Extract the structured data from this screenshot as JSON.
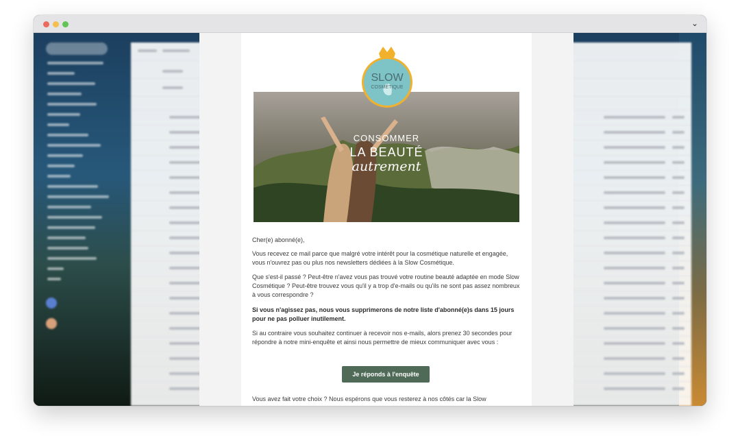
{
  "window": {
    "controls": [
      "close-icon",
      "minimize-icon",
      "zoom-icon"
    ],
    "chevron": "⌄"
  },
  "email": {
    "logo": {
      "top": "SLOW",
      "bottom": "COSMÉTIQUE"
    },
    "hero": {
      "line1": "CONSOMMER",
      "line2": "LA BEAUTÉ",
      "line3": "autrement"
    },
    "greeting": "Cher(e) abonné(e),",
    "paragraphs": [
      "Vous recevez ce mail parce que malgré votre intérêt pour la cosmétique naturelle et engagée, vous n'ouvrez pas ou plus nos newsletters dédiées à la Slow Cosmétique.",
      "Que s'est-il passé ? Peut-être n'avez vous pas trouvé votre routine beauté adaptée en mode Slow Cosmétique ? Peut-être trouvez vous qu'il y a trop d'e-mails ou qu'ils ne sont pas assez nombreux à vous correspondre ?",
      "Si vous n'agissez pas, nous vous supprimerons de notre liste d'abonné(e)s dans 15 jours pour ne pas polluer inutilement.",
      "Si au contraire vous souhaitez continuer à recevoir nos e-mails, alors prenez 30 secondes pour répondre à notre mini-enquête et ainsi nous permettre de mieux communiquer avec vous :"
    ],
    "cta_label": "Je réponds à l'enquête",
    "after_text": "Vous avez fait votre choix ? Nous espérons que vous resterez à nos côtés car la Slow"
  },
  "colors": {
    "cta": "#4f6a57",
    "crown": "#f2b12c",
    "logo_circle": "#7ec3c6"
  }
}
